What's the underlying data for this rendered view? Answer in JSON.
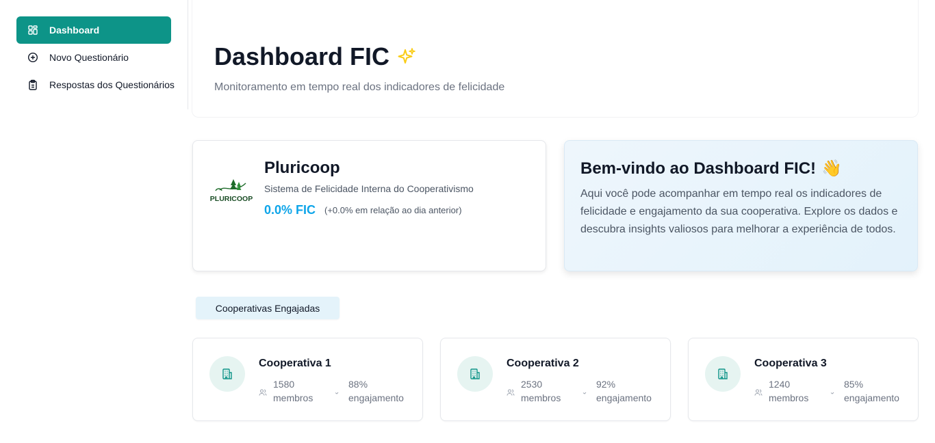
{
  "sidebar": {
    "items": [
      {
        "label": "Dashboard",
        "icon": "layout-grid-icon",
        "active": true
      },
      {
        "label": "Novo Questionário",
        "icon": "plus-circle-icon",
        "active": false
      },
      {
        "label": "Respostas dos Questionários",
        "icon": "clipboard-list-icon",
        "active": false
      }
    ]
  },
  "header": {
    "title": "Dashboard FIC",
    "title_icon": "sparkles-icon",
    "subtitle": "Monitoramento em tempo real dos indicadores de felicidade"
  },
  "org": {
    "logo_text": "PLURICOOP",
    "name": "Pluricoop",
    "description": "Sistema de Felicidade Interna do Cooperativismo",
    "fic": "0.0% FIC",
    "change": "(+0.0% em relação ao dia anterior)"
  },
  "welcome": {
    "title": "Bem-vindo ao Dashboard FIC!",
    "emoji": "👋",
    "text": "Aqui você pode acompanhar em tempo real os indicadores de felicidade e engajamento da sua cooperativa. Explore os dados e descubra insights valiosos para melhorar a experiência de todos."
  },
  "tab": {
    "label": "Cooperativas Engajadas"
  },
  "cooperatives": [
    {
      "name": "Cooperativa 1",
      "members": "1580",
      "members_label": "membros",
      "engagement": "88%",
      "engagement_label": "engajamento"
    },
    {
      "name": "Cooperativa 2",
      "members": "2530",
      "members_label": "membros",
      "engagement": "92%",
      "engagement_label": "engajamento"
    },
    {
      "name": "Cooperativa 3",
      "members": "1240",
      "members_label": "membros",
      "engagement": "85%",
      "engagement_label": "engajamento"
    }
  ],
  "colors": {
    "accent": "#0d9488",
    "fic": "#0ea5e9",
    "logo_green": "#1e6b2a"
  }
}
